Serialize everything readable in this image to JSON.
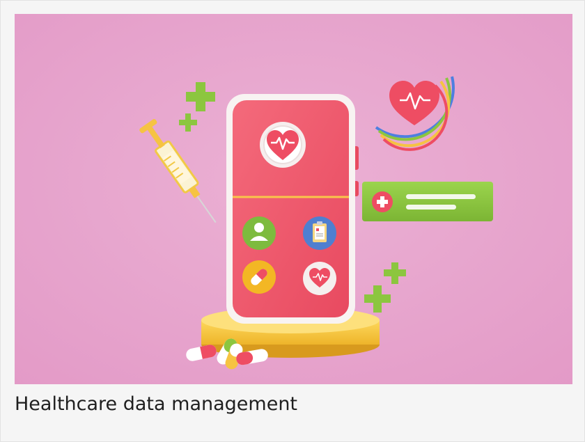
{
  "card": {
    "caption": "Healthcare data management"
  },
  "illustration": {
    "background_color": "#e7a5cd",
    "phone_color": "#ef5a6d",
    "phone_frame_color": "#f7f3f3",
    "accent_green": "#8cc63f",
    "accent_yellow": "#f6c342",
    "icons": [
      "heart-pulse-icon",
      "user-icon",
      "clipboard-icon",
      "pill-icon",
      "heart-icon",
      "plus-icon",
      "syringe-icon"
    ]
  }
}
